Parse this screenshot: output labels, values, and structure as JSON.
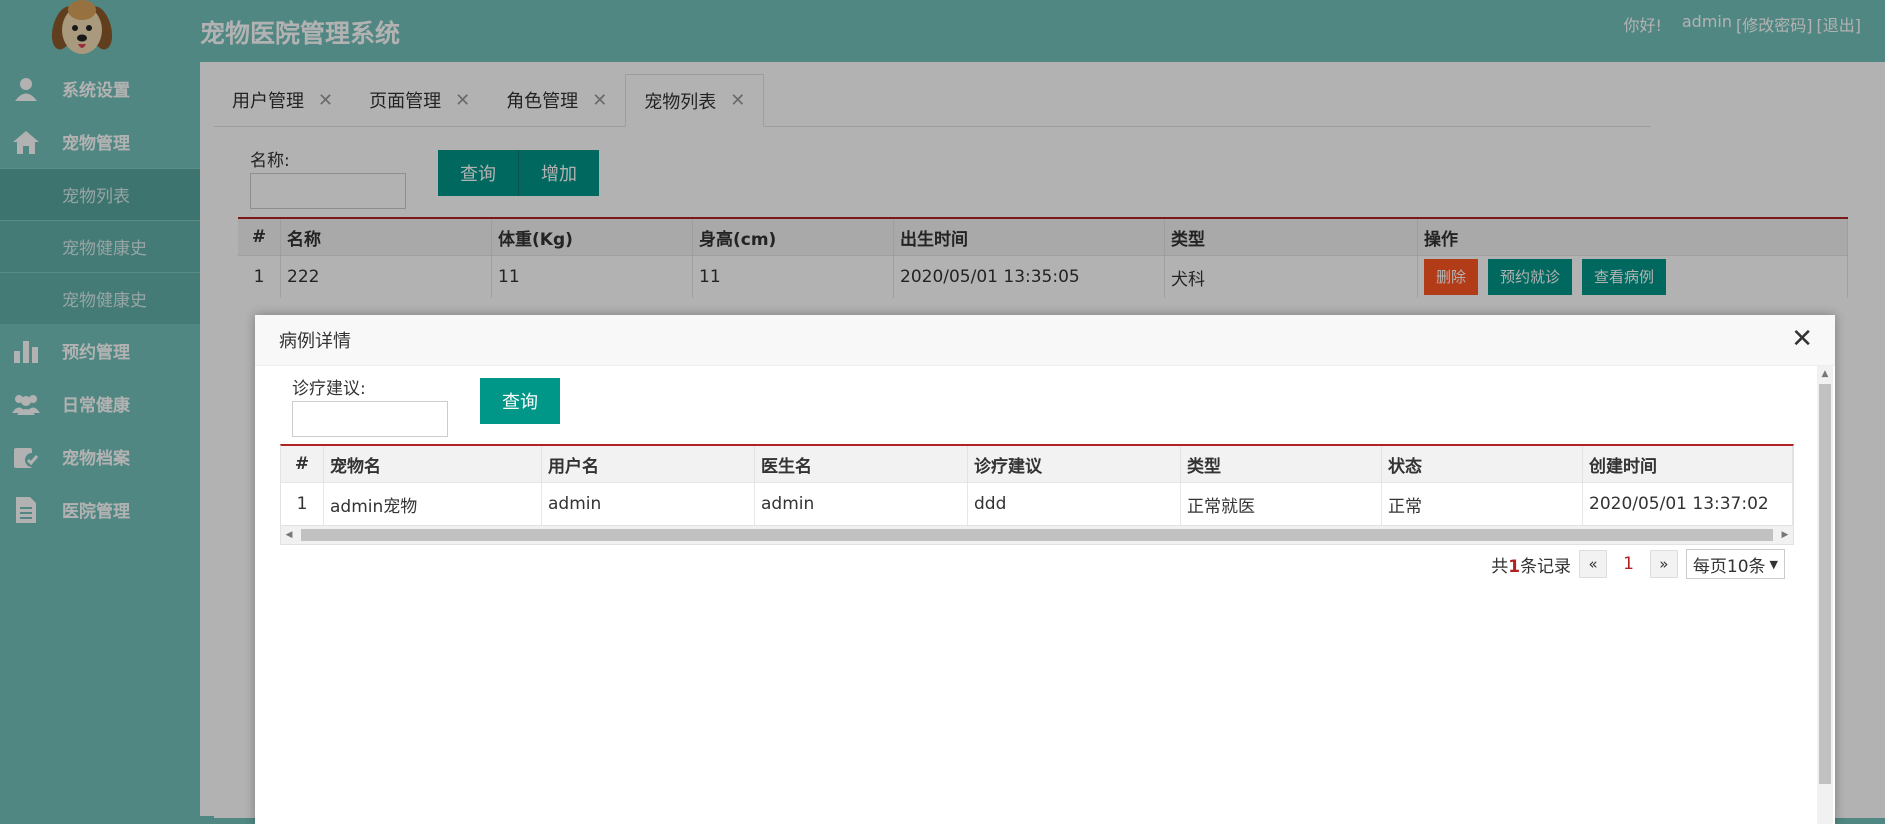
{
  "header": {
    "title": "宠物医院管理系统",
    "greeting": "你好!",
    "username": "admin",
    "change_password": "[修改密码]",
    "logout": "[退出]"
  },
  "sidebar": {
    "items": [
      {
        "label": "系统设置",
        "icon": "user-icon"
      },
      {
        "label": "宠物管理",
        "icon": "home-icon"
      },
      {
        "label": "预约管理",
        "icon": "bar-chart-icon"
      },
      {
        "label": "日常健康",
        "icon": "group-icon"
      },
      {
        "label": "宠物档案",
        "icon": "pet-file-icon"
      },
      {
        "label": "医院管理",
        "icon": "document-icon"
      }
    ],
    "submenu": [
      "宠物列表",
      "宠物健康史",
      "宠物健康史"
    ]
  },
  "tabs": [
    {
      "label": "用户管理"
    },
    {
      "label": "页面管理"
    },
    {
      "label": "角色管理"
    },
    {
      "label": "宠物列表"
    }
  ],
  "tab_close": "✕",
  "main": {
    "search_label": "名称:",
    "search_value": "",
    "query_button": "查询",
    "add_button": "增加",
    "columns": [
      "#",
      "名称",
      "体重(Kg)",
      "身高(cm)",
      "出生时间",
      "类型",
      "操作"
    ],
    "rows": [
      {
        "no": "1",
        "name": "222",
        "weight": "11",
        "height": "11",
        "birth": "2020/05/01 13:35:05",
        "type": "犬科"
      }
    ],
    "row_actions": [
      "删除",
      "预约就诊",
      "查看病例"
    ]
  },
  "modal": {
    "title": "病例详情",
    "close": "✕",
    "search_label": "诊疗建议:",
    "search_value": "",
    "query_button": "查询",
    "columns": [
      "#",
      "宠物名",
      "用户名",
      "医生名",
      "诊疗建议",
      "类型",
      "状态",
      "创建时间"
    ],
    "rows": [
      {
        "no": "1",
        "pet": "admin宠物",
        "user": "admin",
        "doctor": "admin",
        "advice": "ddd",
        "type": "正常就医",
        "status": "正常",
        "created": "2020/05/01 13:37:02"
      }
    ],
    "pager": {
      "total_prefix": "共",
      "total": "1",
      "total_suffix": "条记录",
      "prev": "«",
      "current": "1",
      "next": "»",
      "page_size": "每页10条"
    }
  },
  "colors": {
    "sidebar": "#73c2bb",
    "primary": "#009688",
    "danger": "#ff5722",
    "table_accent": "#b22222"
  }
}
